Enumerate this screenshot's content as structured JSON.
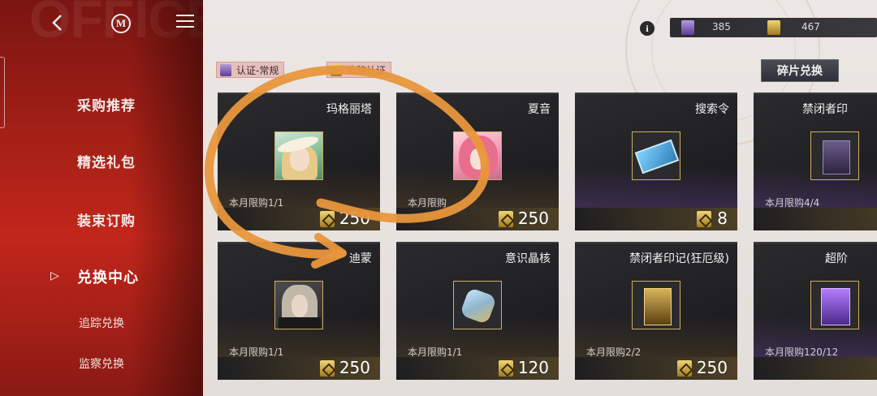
{
  "watermark": "OFFICE PROCUREMENT",
  "topbar": {
    "logo": "M"
  },
  "nav": {
    "items": [
      {
        "label": "采购推荐"
      },
      {
        "label": "精选礼包"
      },
      {
        "label": "装束订购"
      },
      {
        "label": "兑换中心"
      }
    ],
    "active_arrow": "▷",
    "subitems": [
      {
        "label": "追踪兑换"
      },
      {
        "label": "监察兑换"
      }
    ]
  },
  "header": {
    "info_glyph": "i",
    "currencies": [
      {
        "icon": "purple-token-icon",
        "value": "385",
        "color": "#7a5bb8"
      },
      {
        "icon": "gold-token-icon",
        "value": "467",
        "color": "#d4a83a"
      }
    ]
  },
  "filters": [
    {
      "label": "认证-常规",
      "icon": "purple-token-icon"
    },
    {
      "label": "追踪认证",
      "icon": "gold-token-icon"
    }
  ],
  "shard_button": "碎片兑换",
  "items": [
    {
      "name": "玛格丽塔",
      "limit": "本月限购1/1",
      "price": "250"
    },
    {
      "name": "夏音",
      "limit": "本月限购",
      "price": "250"
    },
    {
      "name": "搜索令",
      "limit": "",
      "price": "8"
    },
    {
      "name": "禁闭者印",
      "limit": "本月限购4/4",
      "price": ""
    },
    {
      "name": "迪蒙",
      "limit": "本月限购1/1",
      "price": "250"
    },
    {
      "name": "意识晶核",
      "limit": "本月限购1/1",
      "price": "120"
    },
    {
      "name": "禁闭者印记(狂厄级)",
      "limit": "本月限购2/2",
      "price": "250"
    },
    {
      "name": "超阶",
      "limit": "本月限购120/12",
      "price": ""
    }
  ],
  "colors": {
    "sidebar_red": "#a42016",
    "card_dark": "#1d1d20",
    "annotation_orange": "#e8963c",
    "gold_accent": "#cfae63"
  }
}
